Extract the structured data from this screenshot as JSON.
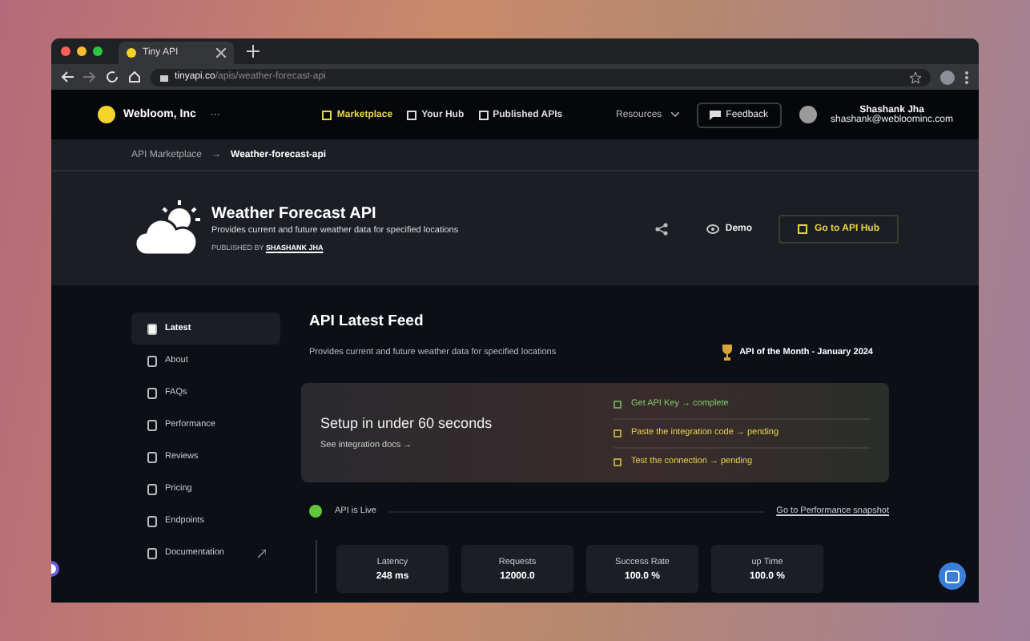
{
  "browser": {
    "tab_title": "Tiny API",
    "url_host": "tinyapi.co",
    "url_path": "/apis/weather-forecast-api"
  },
  "header": {
    "org": "Webloom, Inc",
    "more": "···",
    "nav": [
      {
        "label": "Marketplace",
        "selected": true
      },
      {
        "label": "Your Hub",
        "selected": false
      },
      {
        "label": "Published APIs",
        "selected": false
      }
    ],
    "resources": "Resources",
    "feedback": "Feedback",
    "user": {
      "name": "Shashank Jha",
      "email": "shashank@webloominc.com"
    }
  },
  "breadcrumb": {
    "items": [
      "API Marketplace",
      "Weather-forecast-api"
    ],
    "separator": "→"
  },
  "api": {
    "title": "Weather Forecast API",
    "description": "Provides current and future weather data for specified locations",
    "published_by": "PUBLISHED BY",
    "publisher": "SHASHANK JHA",
    "demo": "Demo",
    "hub_button": "Go to API Hub"
  },
  "sidebar": {
    "items": [
      {
        "label": "Latest",
        "selected": true,
        "external": false
      },
      {
        "label": "About",
        "selected": false,
        "external": false
      },
      {
        "label": "FAQs",
        "selected": false,
        "external": false
      },
      {
        "label": "Performance",
        "selected": false,
        "external": false
      },
      {
        "label": "Reviews",
        "selected": false,
        "external": false
      },
      {
        "label": "Pricing",
        "selected": false,
        "external": false
      },
      {
        "label": "Endpoints",
        "selected": false,
        "external": false
      },
      {
        "label": "Documentation",
        "selected": false,
        "external": true
      }
    ]
  },
  "feed": {
    "title": "API Latest Feed",
    "description": "Provides current and future weather data for specified locations",
    "award": "API of the Month - January 2024",
    "setup": {
      "title": "Setup in under 60 seconds",
      "link": "See integration docs →",
      "step_arrow": "→",
      "steps": [
        {
          "task": "Get API Key",
          "status": "complete"
        },
        {
          "task": "Paste the integration code",
          "status": "pending"
        },
        {
          "task": "Test the connection",
          "status": "pending"
        }
      ]
    },
    "status": {
      "label": "API is Live",
      "live": true,
      "link": "Go to Performance snapshot"
    },
    "metrics": [
      {
        "label": "Latency",
        "value": "248 ms"
      },
      {
        "label": "Requests",
        "value": "12000.0"
      },
      {
        "label": "Success Rate",
        "value": "100.0 %"
      },
      {
        "label": "up Time",
        "value": "100.0 %"
      }
    ]
  }
}
